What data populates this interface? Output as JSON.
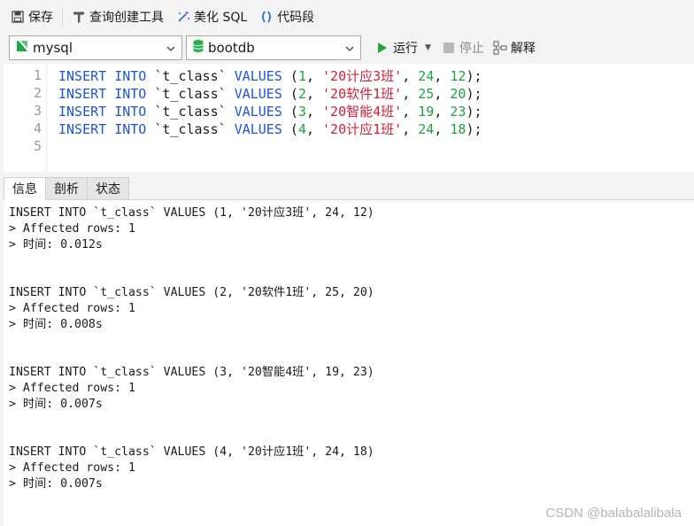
{
  "toolbar": {
    "save": "保存",
    "query_builder": "查询创建工具",
    "beautify": "美化 SQL",
    "snippet": "代码段"
  },
  "connection": {
    "value": "mysql"
  },
  "database": {
    "value": "bootdb"
  },
  "run": {
    "run": "运行",
    "stop": "停止",
    "explain": "解释"
  },
  "editor": {
    "lines": [
      {
        "no": "1",
        "tokens": [
          {
            "t": "kw",
            "v": "INSERT"
          },
          {
            "t": "plain",
            "v": " "
          },
          {
            "t": "kw",
            "v": "INTO"
          },
          {
            "t": "plain",
            "v": " `t_class` "
          },
          {
            "t": "kw",
            "v": "VALUES"
          },
          {
            "t": "plain",
            "v": " ("
          },
          {
            "t": "num",
            "v": "1"
          },
          {
            "t": "plain",
            "v": ", "
          },
          {
            "t": "str",
            "v": "'20计应3班'"
          },
          {
            "t": "plain",
            "v": ", "
          },
          {
            "t": "num",
            "v": "24"
          },
          {
            "t": "plain",
            "v": ", "
          },
          {
            "t": "num",
            "v": "12"
          },
          {
            "t": "plain",
            "v": ");"
          }
        ]
      },
      {
        "no": "2",
        "tokens": [
          {
            "t": "kw",
            "v": "INSERT"
          },
          {
            "t": "plain",
            "v": " "
          },
          {
            "t": "kw",
            "v": "INTO"
          },
          {
            "t": "plain",
            "v": " `t_class` "
          },
          {
            "t": "kw",
            "v": "VALUES"
          },
          {
            "t": "plain",
            "v": " ("
          },
          {
            "t": "num",
            "v": "2"
          },
          {
            "t": "plain",
            "v": ", "
          },
          {
            "t": "str",
            "v": "'20软件1班'"
          },
          {
            "t": "plain",
            "v": ", "
          },
          {
            "t": "num",
            "v": "25"
          },
          {
            "t": "plain",
            "v": ", "
          },
          {
            "t": "num",
            "v": "20"
          },
          {
            "t": "plain",
            "v": ");"
          }
        ]
      },
      {
        "no": "3",
        "tokens": [
          {
            "t": "kw",
            "v": "INSERT"
          },
          {
            "t": "plain",
            "v": " "
          },
          {
            "t": "kw",
            "v": "INTO"
          },
          {
            "t": "plain",
            "v": " `t_class` "
          },
          {
            "t": "kw",
            "v": "VALUES"
          },
          {
            "t": "plain",
            "v": " ("
          },
          {
            "t": "num",
            "v": "3"
          },
          {
            "t": "plain",
            "v": ", "
          },
          {
            "t": "str",
            "v": "'20智能4班'"
          },
          {
            "t": "plain",
            "v": ", "
          },
          {
            "t": "num",
            "v": "19"
          },
          {
            "t": "plain",
            "v": ", "
          },
          {
            "t": "num",
            "v": "23"
          },
          {
            "t": "plain",
            "v": ");"
          }
        ]
      },
      {
        "no": "4",
        "tokens": [
          {
            "t": "kw",
            "v": "INSERT"
          },
          {
            "t": "plain",
            "v": " "
          },
          {
            "t": "kw",
            "v": "INTO"
          },
          {
            "t": "plain",
            "v": " `t_class` "
          },
          {
            "t": "kw",
            "v": "VALUES"
          },
          {
            "t": "plain",
            "v": " ("
          },
          {
            "t": "num",
            "v": "4"
          },
          {
            "t": "plain",
            "v": ", "
          },
          {
            "t": "str",
            "v": "'20计应1班'"
          },
          {
            "t": "plain",
            "v": ", "
          },
          {
            "t": "num",
            "v": "24"
          },
          {
            "t": "plain",
            "v": ", "
          },
          {
            "t": "num",
            "v": "18"
          },
          {
            "t": "plain",
            "v": ");"
          }
        ]
      },
      {
        "no": "5",
        "tokens": []
      }
    ]
  },
  "tabs": [
    "信息",
    "剖析",
    "状态"
  ],
  "results": [
    {
      "sql": "INSERT INTO `t_class` VALUES (1, '20计应3班', 24, 12)",
      "rows": "> Affected rows: 1",
      "time": "> 时间: 0.012s"
    },
    {
      "sql": "INSERT INTO `t_class` VALUES (2, '20软件1班', 25, 20)",
      "rows": "> Affected rows: 1",
      "time": "> 时间: 0.008s"
    },
    {
      "sql": "INSERT INTO `t_class` VALUES (3, '20智能4班', 19, 23)",
      "rows": "> Affected rows: 1",
      "time": "> 时间: 0.007s"
    },
    {
      "sql": "INSERT INTO `t_class` VALUES (4, '20计应1班', 24, 18)",
      "rows": "> Affected rows: 1",
      "time": "> 时间: 0.007s"
    }
  ],
  "watermark": "CSDN @balabalalibala",
  "colors": {
    "keyword": "#1f55d3",
    "string": "#d3203a",
    "number": "#1ea33f",
    "run": "#22a63c",
    "db": "#2bb14a"
  }
}
